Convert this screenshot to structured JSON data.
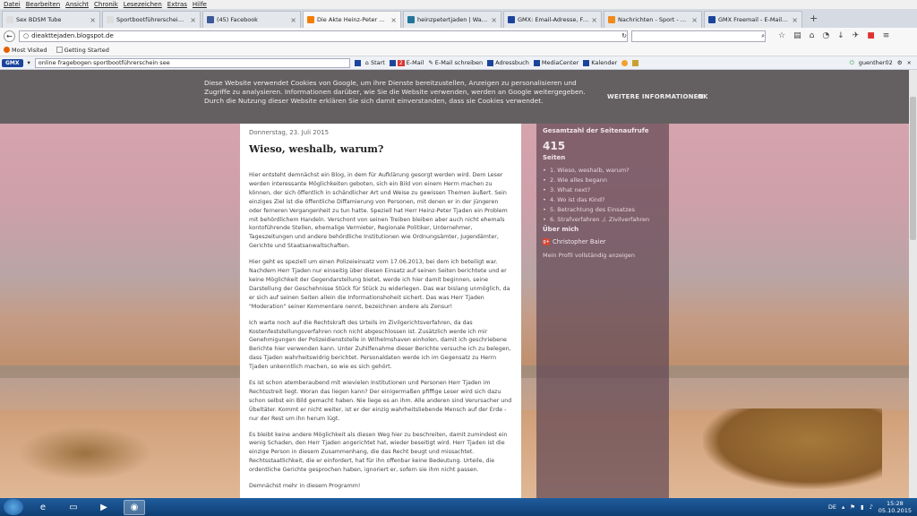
{
  "menu": [
    "Datei",
    "Bearbeiten",
    "Ansicht",
    "Chronik",
    "Lesezeichen",
    "Extras",
    "Hilfe"
  ],
  "tabs": [
    {
      "label": "Sex BDSM Tube",
      "color": "#e6e6e6",
      "active": false
    },
    {
      "label": "Sportbootführerschein See Prüf...",
      "color": "#e6e6e6",
      "active": false
    },
    {
      "label": "(45) Facebook",
      "color": "#3b5998",
      "active": false
    },
    {
      "label": "Die Akte Heinz-Peter Tjade...",
      "color": "#f57d00",
      "active": true
    },
    {
      "label": "heinzpetertjaden | Was and...",
      "color": "#21759b",
      "active": false
    },
    {
      "label": "GMX: Email-Adresse, Free...",
      "color": "#1c449b",
      "active": false
    },
    {
      "label": "Nachrichten - Sport - Doku...",
      "color": "#f08a1d",
      "active": false
    },
    {
      "label": "GMX Freemail - E-Mail ma...",
      "color": "#1c449b",
      "active": false
    }
  ],
  "url": "dieakttejaden.blogspot.de",
  "bookmarks": [
    "Most Visited",
    "Getting Started"
  ],
  "gmx": {
    "logo": "GMX",
    "search_value": "online fragebogen sportbootführerschein see",
    "start": "Start",
    "mail_count": "2",
    "email": "E-Mail",
    "compose": "E-Mail schreiben",
    "addressbook": "Adressbuch",
    "mediacenter": "MediaCenter",
    "calendar": "Kalender",
    "user": "guenther02"
  },
  "cookie": {
    "text": "Diese Website verwendet Cookies von Google, um ihre Dienste bereitzustellen, Anzeigen zu personalisieren und Zugriffe zu analysieren. Informationen darüber, wie Sie die Website verwenden, werden an Google weitergegeben. Durch die Nutzung dieser Website erklären Sie sich damit einverstanden, dass sie Cookies verwendet.",
    "more": "WEITERE INFORMATIONEN",
    "ok": "OK"
  },
  "post": {
    "date": "Donnerstag, 23. Juli 2015",
    "title": "Wieso, weshalb, warum?",
    "p1": "Hier entsteht demnächst ein Blog, in dem für Aufklärung gesorgt werden wird. Dem Leser werden interessante Möglichkeiten geboten, sich ein Bild von einem Herrn machen zu können, der sich öffentlich in schändlicher Art und Weise zu gewissen Themen äußert. Sein einziges Ziel ist die öffentliche Diffamierung von Personen, mit denen er in der jüngeren oder ferneren Vergangenheit zu tun hatte. Speziell hat Herr Heinz-Peter Tjaden ein Problem mit behördlichem Handeln. Verschont von seinen Treiben bleiben aber auch nicht ehemals kontoführende Stellen, ehemalige Vermieter, Regionale Politiker, Unternehmer, Tageszeitungen und andere behördliche Institutionen wie Ordnungsämter, Jugendämter, Gerichte und Staatsanwaltschaften.",
    "p2": "Hier geht es speziell um einen Polizeieinsatz vom 17.06.2013, bei dem ich beteiligt war. Nachdem Herr Tjaden nur einseitig über diesen Einsatz auf seinen Seiten berichtete und er keine Möglichkeit der Gegendarstellung bietet, werde ich hier damit beginnen, seine Darstellung der Geschehnisse Stück für Stück zu widerlegen. Das war bislang unmöglich, da er sich auf seinen Seiten allein die Informationshoheit sichert. Das was Herr Tjaden \"Moderation\" seiner Kommentare nennt, bezeichnen andere als Zensur!",
    "p3": "Ich warte noch auf die Rechtskraft des Urteils im Zivilgerichtsverfahren, da das Kostenfeststellungsverfahren noch nicht abgeschlossen ist. Zusätzlich werde ich mir Genehmigungen der Polizeidienststelle in Wilhelmshaven einholen, damit ich geschriebene Berichte hier verwenden kann. Unter Zuhilfenahme dieser Berichte versuche ich zu belegen, dass Tjaden wahrheitswidrig berichtet. Personaldaten werde ich im Gegensatz zu Herrn Tjaden unkenntlich machen, so wie es sich gehört.",
    "p4": "Es ist schon atemberaubend mit wievielen Institutionen und Personen Herr Tjaden im Rechtsstreit liegt. Woran das liegen kann? Der einigermaßen pfiffige Leser wird sich dazu schon selbst ein Bild gemacht haben. Nie liege es an ihm. Alle anderen sind Verursacher und Übeltäter. Kommt er nicht weiter, ist er der einzig wahrheitsliebende Mensch auf der Erde - nur der Rest um ihn herum lügt.",
    "p5": "Es bleibt keine andere Möglichkeit als diesen Weg hier zu beschreiten, damit zumindest ein wenig Schaden, den Herr Tjaden angerichtet hat, wieder beseitigt wird. Herr Tjaden ist die einzige Person in diesem Zusammenhang, die das Recht beugt und missachtet. Rechtsstaatlichkeit, die er einfordert, hat für ihn offenbar keine Bedeutung. Urteile, die ordentliche Gerichte gesprochen haben, ignoriert er, sofern sie ihm nicht passen.",
    "p6": "Demnächst mehr in diesem Programm!"
  },
  "sidebar": {
    "views_title": "Gesamtzahl der Seitenaufrufe",
    "views_count": "415",
    "pages_title": "Seiten",
    "pages": [
      "1. Wieso, weshalb, warum?",
      "2. Wie alles begann",
      "3. What next?",
      "4. Wo ist das Kind?",
      "5. Betrachtung des Einsatzes",
      "6. Strafverfahren ./. Zivilverfahren"
    ],
    "about_title": "Über mich",
    "author": "Christopher Baier",
    "profile_link": "Mein Profil vollständig anzeigen"
  },
  "taskbar": {
    "lang": "DE",
    "time": "15:28",
    "date": "05.10.2015"
  }
}
